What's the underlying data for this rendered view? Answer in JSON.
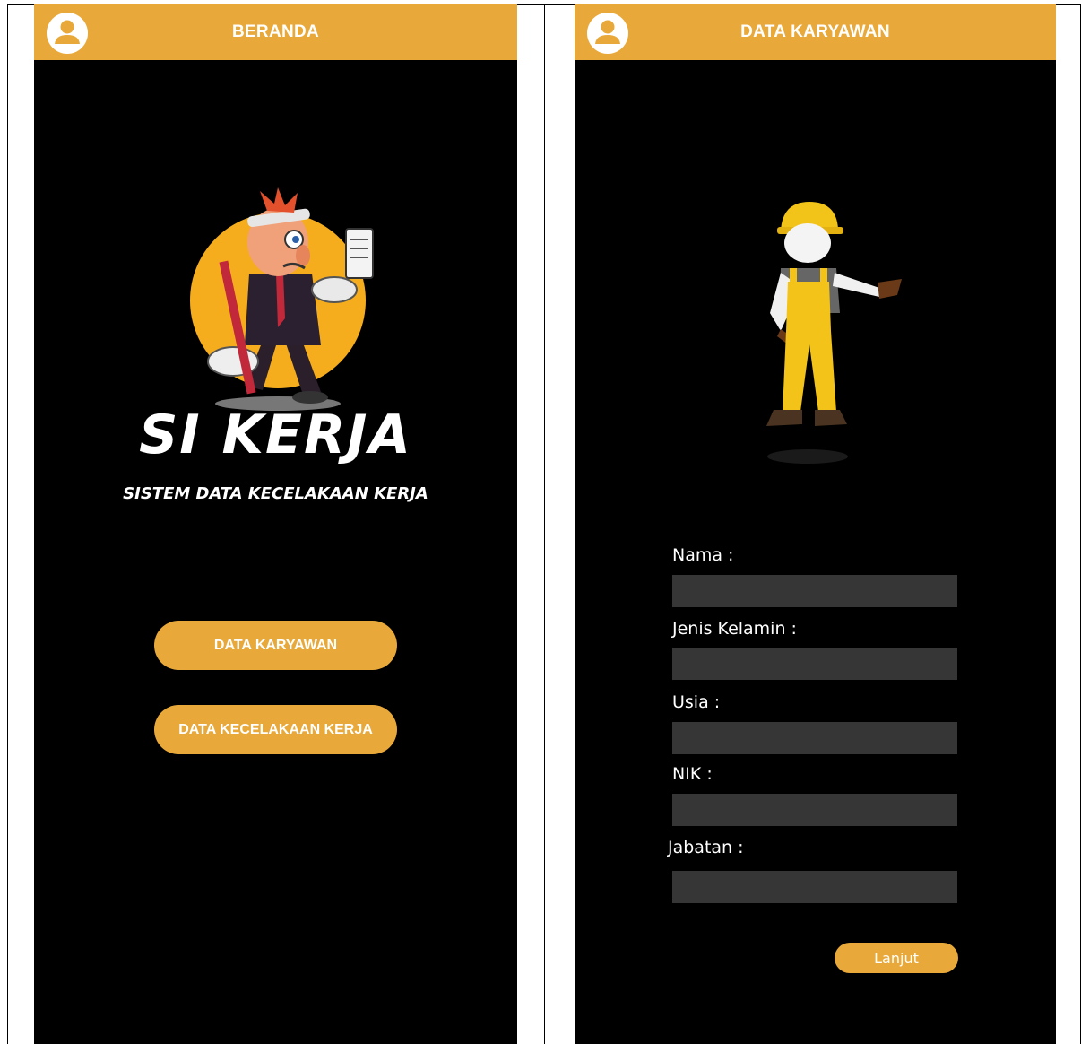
{
  "colors": {
    "accent": "#e8a93a",
    "screen_bg": "#000000",
    "input_bg": "#363636",
    "text": "#ffffff"
  },
  "left_screen": {
    "appbar": {
      "title": "BERANDA",
      "icon": "user-avatar-icon"
    },
    "logo": {
      "text": "SI KERJA",
      "illustration": "injured-worker-cartoon"
    },
    "subtitle": "SISTEM DATA KECELAKAAN KERJA",
    "buttons": [
      {
        "label": "DATA KARYAWAN"
      },
      {
        "label": "DATA KECELAKAAN KERJA"
      }
    ]
  },
  "right_screen": {
    "appbar": {
      "title": "DATA KARYAWAN",
      "icon": "user-avatar-icon"
    },
    "illustration": "construction-worker-figure",
    "form": {
      "fields": [
        {
          "label": "Nama :",
          "value": ""
        },
        {
          "label": "Jenis Kelamin :",
          "value": ""
        },
        {
          "label": "Usia :",
          "value": ""
        },
        {
          "label": "NIK :",
          "value": ""
        },
        {
          "label": "Jabatan :",
          "value": ""
        }
      ],
      "submit_label": "Lanjut"
    }
  }
}
